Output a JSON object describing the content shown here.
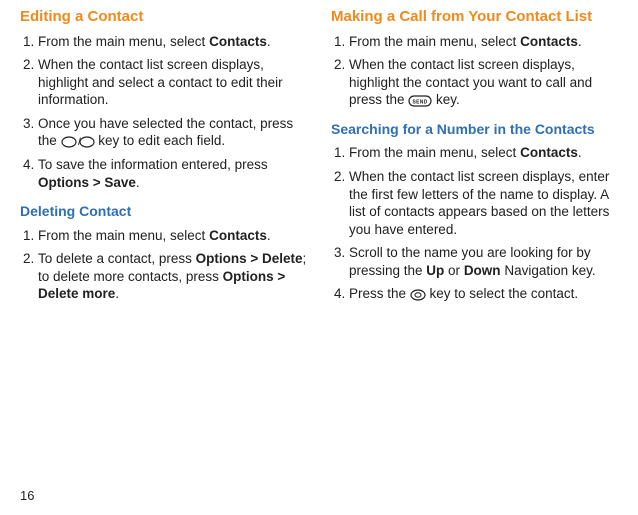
{
  "page_number": "16",
  "left": {
    "section1": {
      "title": "Editing a Contact",
      "steps": [
        {
          "pre": "From the main menu, select ",
          "bold": "Contacts",
          "post": "."
        },
        {
          "text": "When the contact list screen displays, highlight and select a contact to edit their information."
        },
        {
          "pre": "Once you have selected the contact, press the ",
          "icon": "nav",
          "post": " key to edit each field."
        },
        {
          "pre": "To save the information entered, press ",
          "bold": "Options > Save",
          "post": "."
        }
      ]
    },
    "section2": {
      "title": "Deleting Contact",
      "steps": [
        {
          "pre": "From the main menu, select ",
          "bold": "Contacts",
          "post": "."
        },
        {
          "pre": "To delete a contact, press ",
          "bold": "Options > Delete",
          "mid": "; to delete more contacts, press ",
          "bold2": "Options > Delete more",
          "post": "."
        }
      ]
    }
  },
  "right": {
    "section1": {
      "title": "Making a Call from Your Contact List",
      "steps": [
        {
          "pre": "From the main menu, select ",
          "bold": "Contacts",
          "post": "."
        },
        {
          "pre": "When the contact list screen displays, highlight the contact you want to call and press the ",
          "icon": "send",
          "post": " key."
        }
      ]
    },
    "section2": {
      "title": "Searching for a Number in the Contacts",
      "steps": [
        {
          "pre": "From the main menu, select ",
          "bold": "Contacts",
          "post": "."
        },
        {
          "text": "When the contact list screen displays, enter the first few letters of the name to display. A list of contacts appears based on the letters you have entered."
        },
        {
          "pre": "Scroll to the name you are looking for by pressing the ",
          "bold": "Up",
          "mid": " or ",
          "bold2": "Down",
          "post": " Navigation key."
        },
        {
          "pre": "Press the ",
          "icon": "ok",
          "post": " key to select the contact."
        }
      ]
    }
  }
}
